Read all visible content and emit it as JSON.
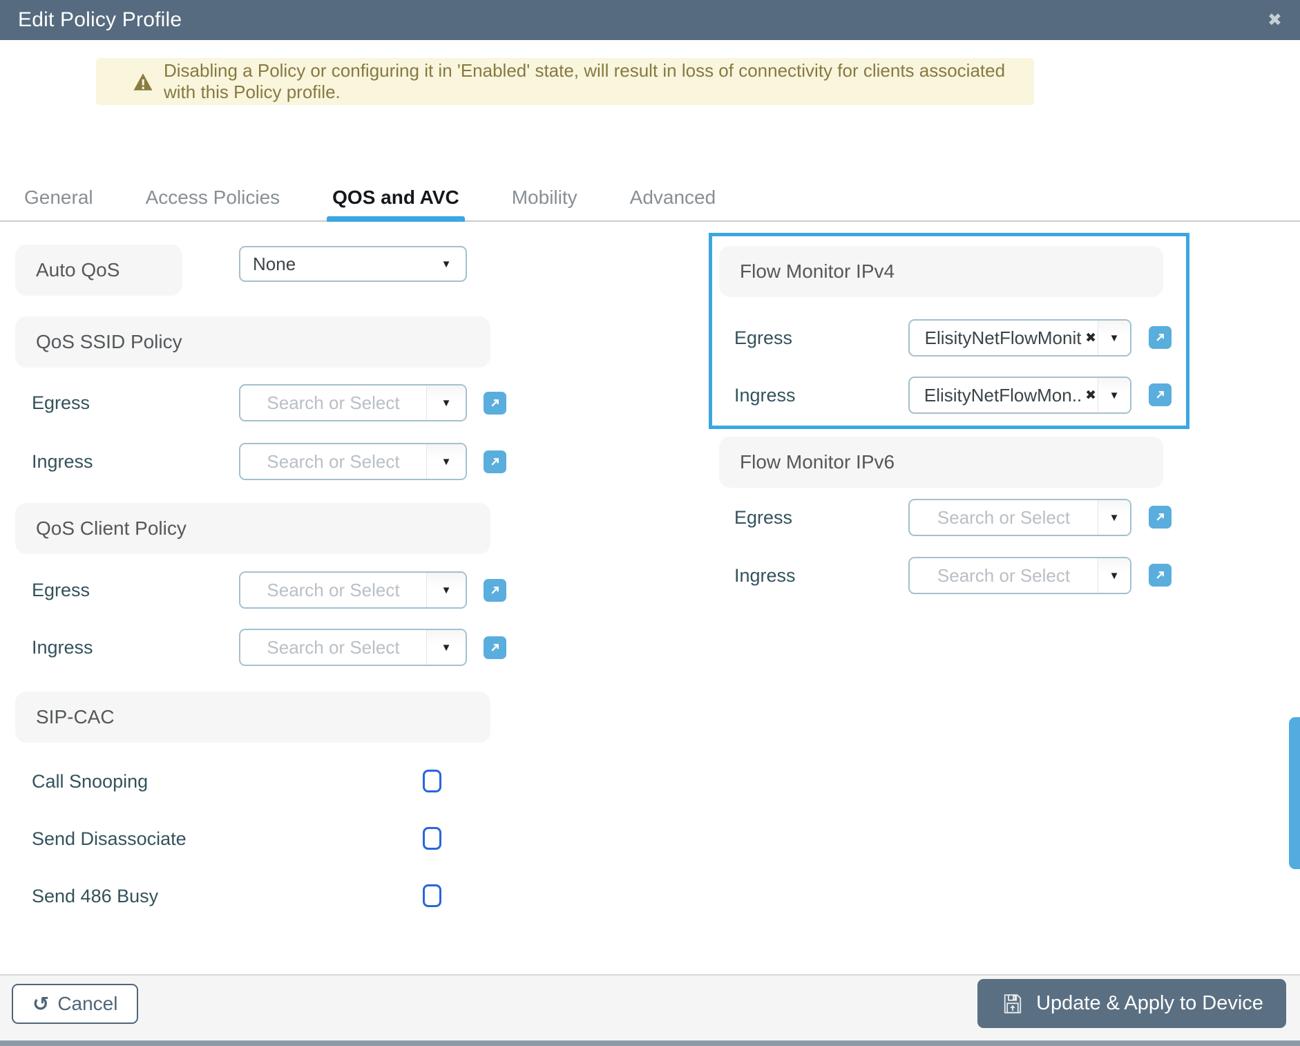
{
  "titlebar": {
    "title": "Edit Policy Profile"
  },
  "icons": {
    "close": "✖",
    "caret": "▼",
    "clear": "✖",
    "undo": "↺",
    "warning": "warning-triangle",
    "external_link": "arrow-up-right",
    "save": "floppy-with-up-arrow"
  },
  "warning": {
    "text": "Disabling a Policy or configuring it in 'Enabled' state, will result in loss of connectivity for clients associated with this Policy profile."
  },
  "tabs": [
    {
      "label": "General",
      "active": false
    },
    {
      "label": "Access Policies",
      "active": false
    },
    {
      "label": "QOS and AVC",
      "active": true
    },
    {
      "label": "Mobility",
      "active": false
    },
    {
      "label": "Advanced",
      "active": false
    }
  ],
  "left": {
    "auto_qos": {
      "label": "Auto QoS",
      "value": "None"
    },
    "qos_ssid": {
      "title": "QoS SSID Policy",
      "rows": [
        {
          "label": "Egress",
          "placeholder": "Search or Select"
        },
        {
          "label": "Ingress",
          "placeholder": "Search or Select"
        }
      ]
    },
    "qos_client": {
      "title": "QoS Client Policy",
      "rows": [
        {
          "label": "Egress",
          "placeholder": "Search or Select"
        },
        {
          "label": "Ingress",
          "placeholder": "Search or Select"
        }
      ]
    },
    "sip_cac": {
      "title": "SIP-CAC",
      "items": [
        {
          "label": "Call Snooping",
          "checked": false
        },
        {
          "label": "Send Disassociate",
          "checked": false
        },
        {
          "label": "Send 486 Busy",
          "checked": false
        }
      ]
    }
  },
  "right": {
    "flow_monitor_ipv4": {
      "title": "Flow Monitor IPv4",
      "highlighted": true,
      "rows": [
        {
          "label": "Egress",
          "value": "ElisityNetFlowMonit",
          "clearable": true
        },
        {
          "label": "Ingress",
          "value": "ElisityNetFlowMon..",
          "clearable": true
        }
      ]
    },
    "flow_monitor_ipv6": {
      "title": "Flow Monitor IPv6",
      "rows": [
        {
          "label": "Egress",
          "placeholder": "Search or Select"
        },
        {
          "label": "Ingress",
          "placeholder": "Search or Select"
        }
      ]
    }
  },
  "footer": {
    "cancel_label": "Cancel",
    "update_label": "Update & Apply to Device"
  },
  "colors": {
    "titlebar_bg": "#566b7f",
    "accent_blue": "#3ba7e0",
    "external_link_bg": "#5aaede",
    "checkbox_blue": "#2a66dd",
    "warning_bg": "#faf5dd",
    "warning_text": "#857a41",
    "label_teal": "#33525c",
    "dropdown_border": "#a3c0cf",
    "update_button_bg": "#5a6f82",
    "scrollbar_thumb": "#54abe0"
  }
}
